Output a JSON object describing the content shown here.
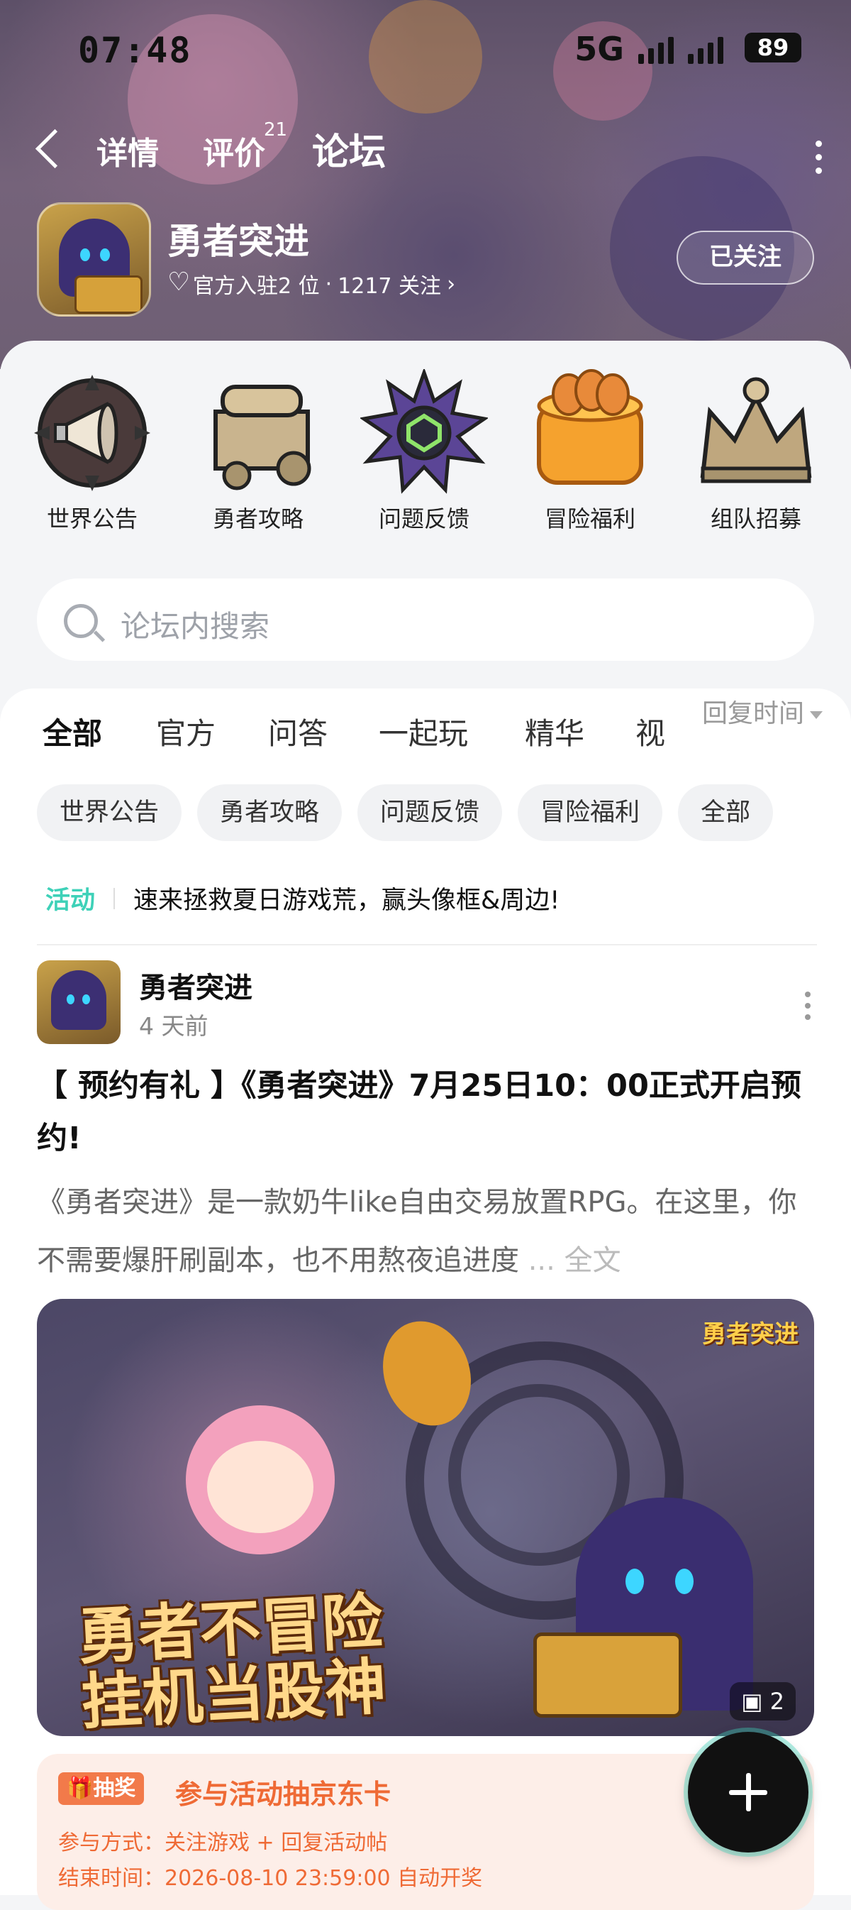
{
  "status_bar": {
    "time": "07:48",
    "network": "5G",
    "battery": "89"
  },
  "nav": {
    "tabs": [
      {
        "label": "详情"
      },
      {
        "label": "评价",
        "badge": "21"
      },
      {
        "label": "论坛"
      }
    ],
    "active_tab": "论坛"
  },
  "game": {
    "name": "勇者突进",
    "meta_official": "官方入驻2 位",
    "meta_dot": "·",
    "meta_followers": "1217 关注",
    "follow_button": "已关注"
  },
  "categories": [
    {
      "label": "世界公告",
      "icon": "megaphone-icon"
    },
    {
      "label": "勇者攻略",
      "icon": "scroll-crate-icon"
    },
    {
      "label": "问题反馈",
      "icon": "spiked-gear-icon"
    },
    {
      "label": "冒险福利",
      "icon": "jelly-cake-icon"
    },
    {
      "label": "组队招募",
      "icon": "crown-icon"
    }
  ],
  "search": {
    "placeholder": "论坛内搜索"
  },
  "feed_tabs": [
    {
      "label": "全部"
    },
    {
      "label": "官方"
    },
    {
      "label": "问答"
    },
    {
      "label": "一起玩"
    },
    {
      "label": "精华"
    },
    {
      "label": "视"
    }
  ],
  "sort_label": "回复时间",
  "filter_chips": [
    "世界公告",
    "勇者攻略",
    "问题反馈",
    "冒险福利",
    "全部"
  ],
  "activity": {
    "tag": "活动",
    "text": "速来拯救夏日游戏荒，赢头像框&周边!"
  },
  "post": {
    "author": "勇者突进",
    "time_ago": "4 天前",
    "title": "【 预约有礼 】《勇者突进》7月25日10：00正式开启预约!",
    "body": "《勇者突进》是一款奶牛like自由交易放置RPG。在这里，你不需要爆肝刷副本，也不用熬夜追进度",
    "more_label": "... 全文",
    "cover": {
      "slogan_line1": "勇者不冒险",
      "slogan_line2": "挂机当股神",
      "logo": "勇者突进",
      "image_count": "2"
    }
  },
  "lottery": {
    "tag": "抽奖",
    "title": "参与活动抽京东卡",
    "method": "参与方式：关注游戏 + 回复活动帖",
    "end_time": "结束时间：2026-08-10 23:59:00 自动开奖"
  },
  "colors": {
    "accent": "#3ed1b8",
    "lottery": "#ef6a35"
  }
}
